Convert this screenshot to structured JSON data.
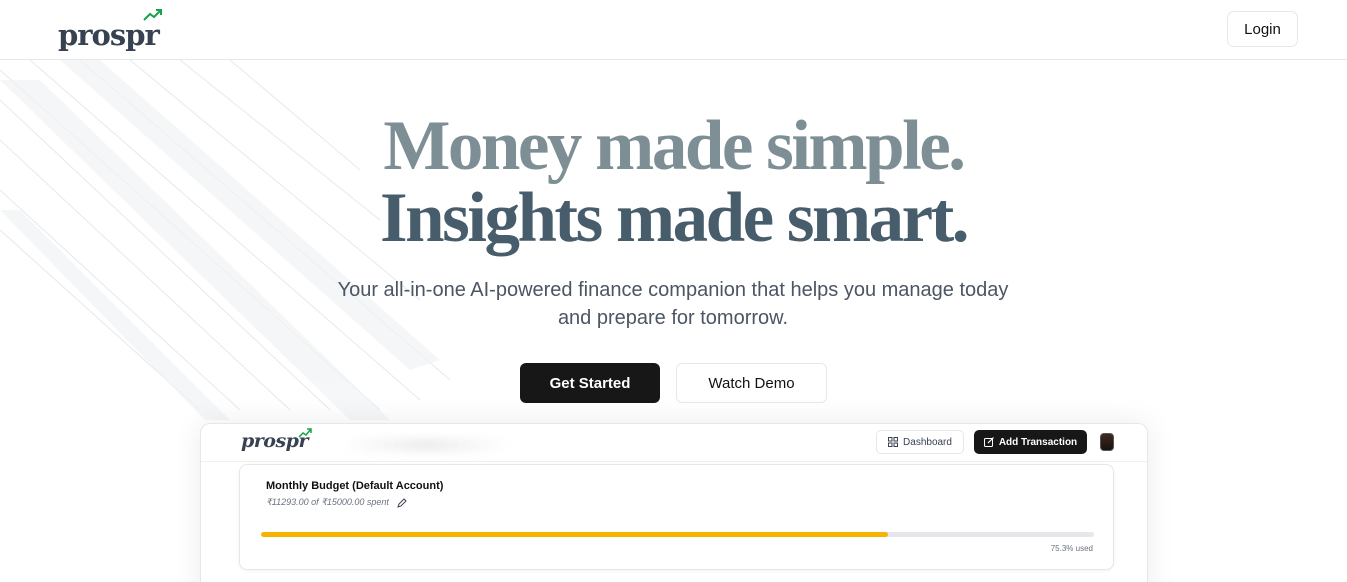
{
  "header": {
    "logo_text": "prospr",
    "login_label": "Login"
  },
  "hero": {
    "title_line1": "Money made simple.",
    "title_line2": "Insights made smart.",
    "subtitle": "Your all-in-one AI-powered finance companion that helps you manage today and prepare for tomorrow.",
    "primary_cta": "Get Started",
    "secondary_cta": "Watch Demo"
  },
  "preview": {
    "logo_text": "prospr",
    "dashboard_label": "Dashboard",
    "add_transaction_label": "Add Transaction",
    "budget": {
      "title": "Monthly Budget (Default Account)",
      "spent_text": "₹11293.00 of ₹15000.00 spent",
      "progress_percent": 75.3,
      "used_label": "75.3% used"
    }
  },
  "colors": {
    "accent_green": "#16a34a",
    "progress_yellow": "#f4b400",
    "primary_button": "#171717"
  },
  "icons": {
    "logo_arrow": "trending-up-icon",
    "dashboard": "layout-grid-icon",
    "add_transaction": "pen-square-icon",
    "edit_budget": "pencil-icon"
  }
}
